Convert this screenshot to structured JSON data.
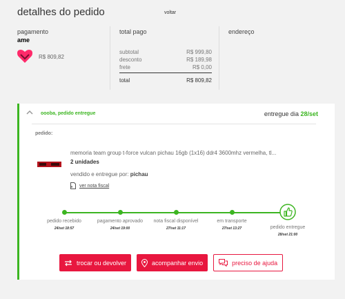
{
  "header": {
    "title": "detalhes do pedido",
    "back_label": "voltar"
  },
  "summary": {
    "payment_label": "pagamento",
    "payment_method": "ame",
    "payment_amount": "R$ 809,82",
    "total_paid_label": "total pago",
    "address_label": "endereço",
    "rows": [
      {
        "label": "subtotal",
        "value": "R$ 999,80"
      },
      {
        "label": "desconto",
        "value": "R$ 189,98"
      },
      {
        "label": "frete",
        "value": "R$ 0,00"
      }
    ],
    "total": {
      "label": "total",
      "value": "R$ 809,82"
    }
  },
  "order": {
    "status": "oooba, pedido entregue",
    "delivered_prefix": "entregue dia",
    "delivered_date": "28/set",
    "pedido_label": "pedido:",
    "product_name": "memoria team group t-force vulcan pichau 16gb (1x16) ddr4 3600mhz vermelha, tl...",
    "units": "2 unidades",
    "seller_prefix": "vendido e entregue por:",
    "seller": "pichau",
    "invoice_label": "ver nota fiscal"
  },
  "timeline": [
    {
      "label": "pedido recebido",
      "date": "24/set 18:57"
    },
    {
      "label": "pagamento aprovado",
      "date": "24/set 19:00"
    },
    {
      "label": "nota fiscal disponível",
      "date": "27/set 11:17"
    },
    {
      "label": "em transporte",
      "date": "27/set 13:27"
    },
    {
      "label": "pedido entregue",
      "date": "28/set 21:00"
    }
  ],
  "actions": {
    "exchange_label": "trocar ou devolver",
    "track_label": "acompanhar envio",
    "help_label": "preciso de ajuda"
  },
  "colors": {
    "accent": "#e8173f",
    "success": "#3cb521"
  },
  "icons": {
    "ame": "ame-logo-icon",
    "invoice": "document-icon",
    "exchange": "arrows-icon",
    "track": "location-pin-icon",
    "help": "chat-icon",
    "delivered": "thumbs-up-icon",
    "collapse": "chevron-up-icon"
  }
}
